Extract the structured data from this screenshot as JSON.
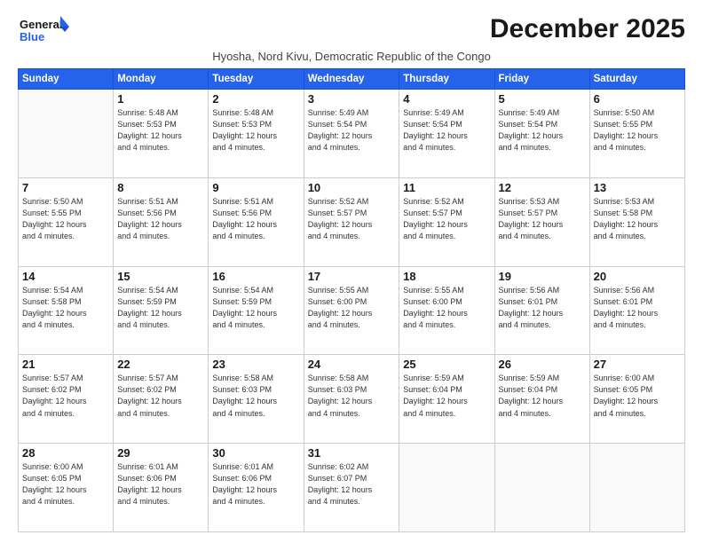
{
  "logo": {
    "line1": "General",
    "line2": "Blue"
  },
  "title": "December 2025",
  "subtitle": "Hyosha, Nord Kivu, Democratic Republic of the Congo",
  "days_of_week": [
    "Sunday",
    "Monday",
    "Tuesday",
    "Wednesday",
    "Thursday",
    "Friday",
    "Saturday"
  ],
  "weeks": [
    [
      {
        "day": "",
        "info": ""
      },
      {
        "day": "1",
        "info": "Sunrise: 5:48 AM\nSunset: 5:53 PM\nDaylight: 12 hours\nand 4 minutes."
      },
      {
        "day": "2",
        "info": "Sunrise: 5:48 AM\nSunset: 5:53 PM\nDaylight: 12 hours\nand 4 minutes."
      },
      {
        "day": "3",
        "info": "Sunrise: 5:49 AM\nSunset: 5:54 PM\nDaylight: 12 hours\nand 4 minutes."
      },
      {
        "day": "4",
        "info": "Sunrise: 5:49 AM\nSunset: 5:54 PM\nDaylight: 12 hours\nand 4 minutes."
      },
      {
        "day": "5",
        "info": "Sunrise: 5:49 AM\nSunset: 5:54 PM\nDaylight: 12 hours\nand 4 minutes."
      },
      {
        "day": "6",
        "info": "Sunrise: 5:50 AM\nSunset: 5:55 PM\nDaylight: 12 hours\nand 4 minutes."
      }
    ],
    [
      {
        "day": "7",
        "info": "Sunrise: 5:50 AM\nSunset: 5:55 PM\nDaylight: 12 hours\nand 4 minutes."
      },
      {
        "day": "8",
        "info": "Sunrise: 5:51 AM\nSunset: 5:56 PM\nDaylight: 12 hours\nand 4 minutes."
      },
      {
        "day": "9",
        "info": "Sunrise: 5:51 AM\nSunset: 5:56 PM\nDaylight: 12 hours\nand 4 minutes."
      },
      {
        "day": "10",
        "info": "Sunrise: 5:52 AM\nSunset: 5:57 PM\nDaylight: 12 hours\nand 4 minutes."
      },
      {
        "day": "11",
        "info": "Sunrise: 5:52 AM\nSunset: 5:57 PM\nDaylight: 12 hours\nand 4 minutes."
      },
      {
        "day": "12",
        "info": "Sunrise: 5:53 AM\nSunset: 5:57 PM\nDaylight: 12 hours\nand 4 minutes."
      },
      {
        "day": "13",
        "info": "Sunrise: 5:53 AM\nSunset: 5:58 PM\nDaylight: 12 hours\nand 4 minutes."
      }
    ],
    [
      {
        "day": "14",
        "info": "Sunrise: 5:54 AM\nSunset: 5:58 PM\nDaylight: 12 hours\nand 4 minutes."
      },
      {
        "day": "15",
        "info": "Sunrise: 5:54 AM\nSunset: 5:59 PM\nDaylight: 12 hours\nand 4 minutes."
      },
      {
        "day": "16",
        "info": "Sunrise: 5:54 AM\nSunset: 5:59 PM\nDaylight: 12 hours\nand 4 minutes."
      },
      {
        "day": "17",
        "info": "Sunrise: 5:55 AM\nSunset: 6:00 PM\nDaylight: 12 hours\nand 4 minutes."
      },
      {
        "day": "18",
        "info": "Sunrise: 5:55 AM\nSunset: 6:00 PM\nDaylight: 12 hours\nand 4 minutes."
      },
      {
        "day": "19",
        "info": "Sunrise: 5:56 AM\nSunset: 6:01 PM\nDaylight: 12 hours\nand 4 minutes."
      },
      {
        "day": "20",
        "info": "Sunrise: 5:56 AM\nSunset: 6:01 PM\nDaylight: 12 hours\nand 4 minutes."
      }
    ],
    [
      {
        "day": "21",
        "info": "Sunrise: 5:57 AM\nSunset: 6:02 PM\nDaylight: 12 hours\nand 4 minutes."
      },
      {
        "day": "22",
        "info": "Sunrise: 5:57 AM\nSunset: 6:02 PM\nDaylight: 12 hours\nand 4 minutes."
      },
      {
        "day": "23",
        "info": "Sunrise: 5:58 AM\nSunset: 6:03 PM\nDaylight: 12 hours\nand 4 minutes."
      },
      {
        "day": "24",
        "info": "Sunrise: 5:58 AM\nSunset: 6:03 PM\nDaylight: 12 hours\nand 4 minutes."
      },
      {
        "day": "25",
        "info": "Sunrise: 5:59 AM\nSunset: 6:04 PM\nDaylight: 12 hours\nand 4 minutes."
      },
      {
        "day": "26",
        "info": "Sunrise: 5:59 AM\nSunset: 6:04 PM\nDaylight: 12 hours\nand 4 minutes."
      },
      {
        "day": "27",
        "info": "Sunrise: 6:00 AM\nSunset: 6:05 PM\nDaylight: 12 hours\nand 4 minutes."
      }
    ],
    [
      {
        "day": "28",
        "info": "Sunrise: 6:00 AM\nSunset: 6:05 PM\nDaylight: 12 hours\nand 4 minutes."
      },
      {
        "day": "29",
        "info": "Sunrise: 6:01 AM\nSunset: 6:06 PM\nDaylight: 12 hours\nand 4 minutes."
      },
      {
        "day": "30",
        "info": "Sunrise: 6:01 AM\nSunset: 6:06 PM\nDaylight: 12 hours\nand 4 minutes."
      },
      {
        "day": "31",
        "info": "Sunrise: 6:02 AM\nSunset: 6:07 PM\nDaylight: 12 hours\nand 4 minutes."
      },
      {
        "day": "",
        "info": ""
      },
      {
        "day": "",
        "info": ""
      },
      {
        "day": "",
        "info": ""
      }
    ]
  ]
}
